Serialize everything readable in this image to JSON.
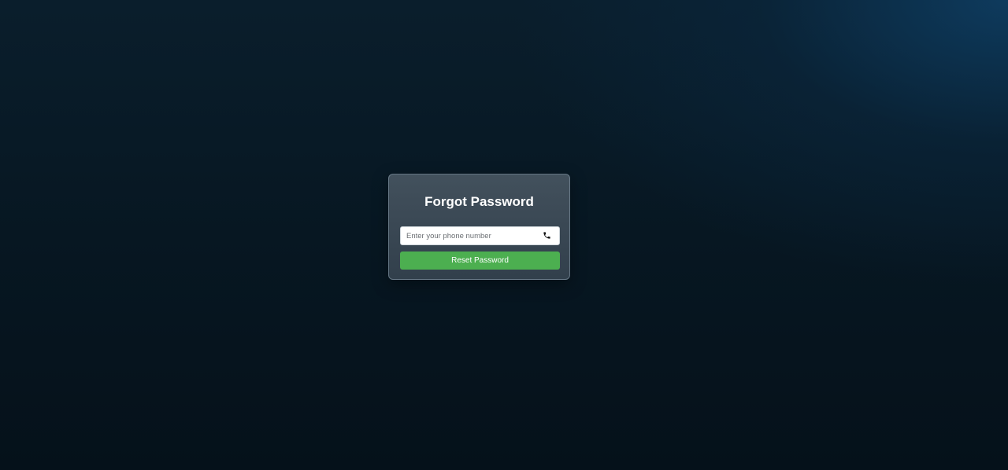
{
  "card": {
    "title": "Forgot Password"
  },
  "phone_field": {
    "placeholder": "Enter your phone number",
    "value": "",
    "icon": "phone-icon"
  },
  "reset_button": {
    "label": "Reset Password"
  },
  "colors": {
    "button_bg": "#4caf50",
    "card_bg": "#3c4b57",
    "page_bg_dark": "#05111a",
    "page_bg_accent": "#0e3c60"
  }
}
